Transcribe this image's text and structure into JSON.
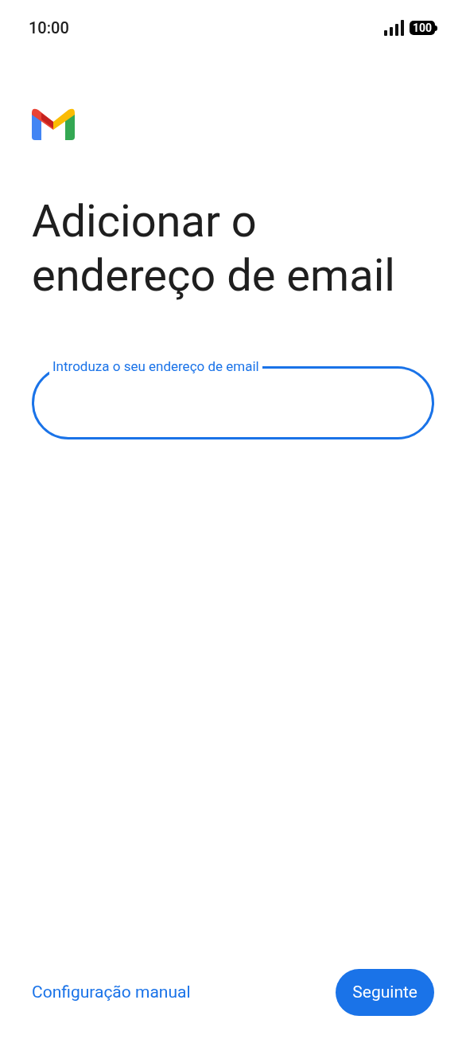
{
  "status_bar": {
    "time": "10:00",
    "battery": "100"
  },
  "title": "Adicionar o endereço de email",
  "email_field": {
    "label": "Introduza o seu endereço de email",
    "focused": true
  },
  "footer": {
    "link": "Configuração manual",
    "button": "Seguinte"
  }
}
